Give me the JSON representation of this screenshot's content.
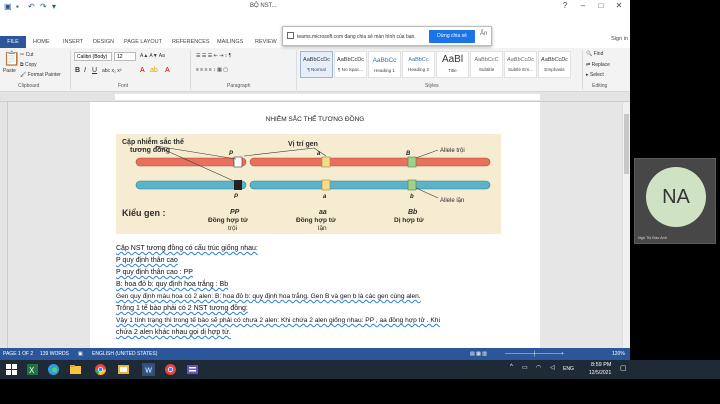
{
  "window": {
    "title": "BỘ NST...",
    "file_tab": "FILE",
    "tabs": [
      "HOME",
      "INSERT",
      "DESIGN",
      "PAGE LAYOUT",
      "REFERENCES",
      "MAILINGS",
      "REVIEW"
    ],
    "sign_in": "Sign in"
  },
  "share_banner": {
    "text": "teams.microsoft.com đang chia sẻ màn hình của bạn.",
    "stop_button": "Dừng chia sẻ",
    "hide_button": "Ẩn"
  },
  "ribbon": {
    "clipboard": {
      "paste": "Paste",
      "cut": "Cut",
      "copy": "Copy",
      "format_painter": "Format Painter",
      "group": "Clipboard"
    },
    "font": {
      "name": "Calibri (Body)",
      "size": "12",
      "group": "Font"
    },
    "paragraph": {
      "group": "Paragraph"
    },
    "styles": {
      "group": "Styles",
      "items": [
        {
          "preview": "AaBbCcDc",
          "label": "¶ Normal"
        },
        {
          "preview": "AaBbCcDc",
          "label": "¶ No Spac..."
        },
        {
          "preview": "AaBbCc",
          "label": "Heading 1"
        },
        {
          "preview": "AaBbCc",
          "label": "Heading 2"
        },
        {
          "preview": "AaBl",
          "label": "Title"
        },
        {
          "preview": "AaBbCcC",
          "label": "Subtitle"
        },
        {
          "preview": "AaBbCcDc",
          "label": "Subtle Em..."
        },
        {
          "preview": "AaBbCcDc",
          "label": "Emphasis"
        }
      ]
    },
    "editing": {
      "find": "Find",
      "replace": "Replace",
      "select": "Select",
      "group": "Editing"
    }
  },
  "document": {
    "heading": "NHIỄM SẮC THỂ TƯƠNG ĐỒNG",
    "figure": {
      "label_pair": "Cặp nhiễm sắc thể tương đồng",
      "label_locus": "Vị trí gen",
      "label_allele_dominant": "Allele trội",
      "label_allele_recessive": "Allele lặn",
      "letter_P": "P",
      "letter_a": "a",
      "letter_B": "B",
      "letter_b": "b",
      "genotype_label": "Kiểu gen :",
      "genotypes": [
        {
          "code": "PP",
          "desc1": "Đồng hợp tử",
          "desc2": "trội"
        },
        {
          "code": "aa",
          "desc1": "Đồng hợp tử",
          "desc2": "lặn"
        },
        {
          "code": "Bb",
          "desc1": "Dị hợp tử",
          "desc2": ""
        }
      ]
    },
    "lines": [
      "Cặp NST tương đồng có cấu trúc giống nhau:",
      "P quy định thân cao",
      "P quy định thân cao : PP",
      "B: hoa đỏ       b: quy định hoa trắng : Bb",
      "Gen quy định màu hoa có 2 alen: B: hoa đỏ      b: quy định hoa trắng. Gen B và gen b là các gen cùng alen.",
      "Trông 1 tế bào phải có 2 NST tương đồng:",
      "Vậy 1 tính trạng thì trong tế bào sẽ phải có chưa 2 alen: Khi chứa 2 alen giống nhau: PP , aa đồng hợp tử . Khi",
      "chứa 2 alen khác nhau gọi dị hợp tử."
    ]
  },
  "statusbar": {
    "page": "PAGE 1 OF 2",
    "words": "139 WORDS",
    "language": "ENGLISH (UNITED STATES)",
    "zoom": "120%"
  },
  "teams": {
    "initials": "NA",
    "name": "Ngô Thị Đào Anh"
  },
  "taskbar": {
    "language": "ENG",
    "time": "8:59 PM",
    "date": "12/5/2021"
  }
}
